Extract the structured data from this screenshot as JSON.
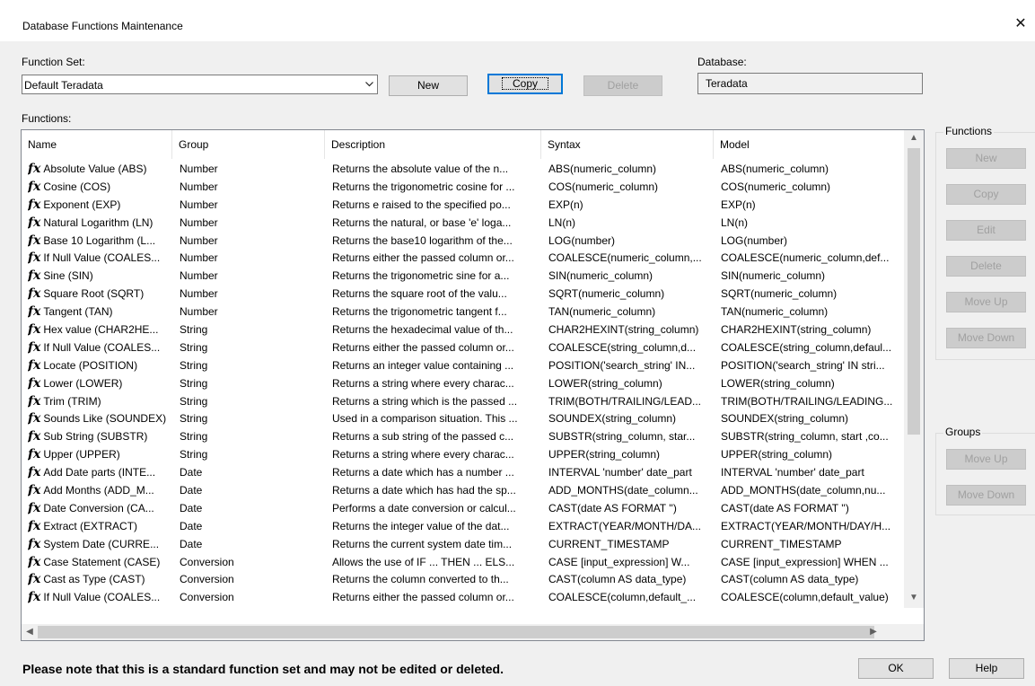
{
  "window": {
    "title": "Database Functions Maintenance",
    "close_icon": "close-icon"
  },
  "function_set": {
    "label": "Function Set:",
    "value": "Default Teradata"
  },
  "top_buttons": {
    "new": "New",
    "copy": "Copy",
    "delete": "Delete"
  },
  "database": {
    "label": "Database:",
    "value": "Teradata"
  },
  "functions_label": "Functions:",
  "table": {
    "columns": [
      "Name",
      "Group",
      "Description",
      "Syntax",
      "Model"
    ],
    "rows": [
      [
        "Absolute Value (ABS)",
        "Number",
        "Returns the absolute value of the n...",
        "ABS(numeric_column)",
        "ABS(numeric_column)"
      ],
      [
        "Cosine (COS)",
        "Number",
        "Returns the trigonometric cosine for ...",
        "COS(numeric_column)",
        "COS(numeric_column)"
      ],
      [
        "Exponent (EXP)",
        "Number",
        "Returns e raised to the specified po...",
        "EXP(n)",
        "EXP(n)"
      ],
      [
        "Natural Logarithm (LN)",
        "Number",
        "Returns the natural, or base 'e' loga...",
        "LN(n)",
        "LN(n)"
      ],
      [
        "Base 10 Logarithm (L...",
        "Number",
        "Returns the base10 logarithm of the...",
        "LOG(number)",
        "LOG(number)"
      ],
      [
        "If Null Value (COALES...",
        "Number",
        "Returns either the passed column or...",
        "COALESCE(numeric_column,...",
        "COALESCE(numeric_column,def..."
      ],
      [
        "Sine (SIN)",
        "Number",
        "Returns the trigonometric sine for a...",
        "SIN(numeric_column)",
        "SIN(numeric_column)"
      ],
      [
        "Square Root (SQRT)",
        "Number",
        "Returns the square root of the valu...",
        "SQRT(numeric_column)",
        "SQRT(numeric_column)"
      ],
      [
        "Tangent (TAN)",
        "Number",
        "Returns the trigonometric tangent f...",
        "TAN(numeric_column)",
        "TAN(numeric_column)"
      ],
      [
        "Hex value (CHAR2HE...",
        "String",
        "Returns the hexadecimal value of th...",
        "CHAR2HEXINT(string_column)",
        "CHAR2HEXINT(string_column)"
      ],
      [
        "If Null Value (COALES...",
        "String",
        "Returns either the passed column or...",
        "COALESCE(string_column,d...",
        "COALESCE(string_column,defaul..."
      ],
      [
        "Locate (POSITION)",
        "String",
        "Returns an integer value containing ...",
        "POSITION('search_string' IN...",
        "POSITION('search_string' IN stri..."
      ],
      [
        "Lower (LOWER)",
        "String",
        "Returns a string where every charac...",
        "LOWER(string_column)",
        "LOWER(string_column)"
      ],
      [
        "Trim (TRIM)",
        "String",
        "Returns a string which is the passed ...",
        "TRIM(BOTH/TRAILING/LEAD...",
        "TRIM(BOTH/TRAILING/LEADING..."
      ],
      [
        "Sounds Like (SOUNDEX)",
        "String",
        "Used in a comparison situation. This ...",
        "SOUNDEX(string_column)",
        "SOUNDEX(string_column)"
      ],
      [
        "Sub String (SUBSTR)",
        "String",
        "Returns a sub string of the passed c...",
        "SUBSTR(string_column, star...",
        "SUBSTR(string_column, start ,co..."
      ],
      [
        "Upper (UPPER)",
        "String",
        "Returns a string where every charac...",
        "UPPER(string_column)",
        "UPPER(string_column)"
      ],
      [
        "Add Date parts (INTE...",
        "Date",
        "Returns a date which has a number ...",
        "INTERVAL 'number' date_part",
        "INTERVAL 'number' date_part"
      ],
      [
        "Add Months (ADD_M...",
        "Date",
        "Returns a date which has had the sp...",
        "ADD_MONTHS(date_column...",
        "ADD_MONTHS(date_column,nu..."
      ],
      [
        "Date Conversion (CA...",
        "Date",
        "Performs a date conversion or calcul...",
        "CAST(date AS FORMAT '')",
        "CAST(date AS FORMAT '')"
      ],
      [
        "Extract (EXTRACT)",
        "Date",
        "Returns the integer value of the dat...",
        "EXTRACT(YEAR/MONTH/DA...",
        "EXTRACT(YEAR/MONTH/DAY/H..."
      ],
      [
        "System Date (CURRE...",
        "Date",
        "Returns the current system date tim...",
        "CURRENT_TIMESTAMP",
        "CURRENT_TIMESTAMP"
      ],
      [
        "Case Statement (CASE)",
        "Conversion",
        "Allows the use of IF ... THEN ... ELS...",
        "CASE [input_expression] W...",
        "CASE [input_expression] WHEN ..."
      ],
      [
        "Cast as Type (CAST)",
        "Conversion",
        "Returns the column converted to th...",
        "CAST(column AS data_type)",
        "CAST(column AS data_type)"
      ],
      [
        "If Null Value (COALES...",
        "Conversion",
        "Returns either the passed column or...",
        "COALESCE(column,default_...",
        "COALESCE(column,default_value)"
      ]
    ]
  },
  "functions_group": {
    "title": "Functions",
    "buttons": [
      "New",
      "Copy",
      "Edit",
      "Delete",
      "Move Up",
      "Move Down"
    ]
  },
  "groups_group": {
    "title": "Groups",
    "buttons": [
      "Move Up",
      "Move Down"
    ]
  },
  "note": "Please note that this is a standard function set and may not be edited or deleted.",
  "bottom_buttons": {
    "ok": "OK",
    "help": "Help"
  },
  "icons": {
    "row_icon": "fx-icon"
  }
}
